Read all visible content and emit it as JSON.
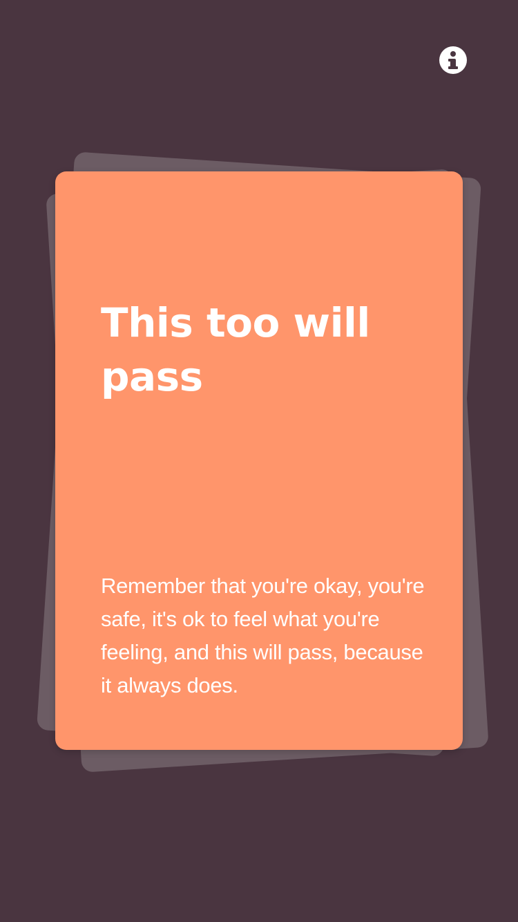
{
  "header": {
    "info_icon": "info-icon"
  },
  "card": {
    "title": "This too will pass",
    "body": "Remember that you're okay, you're safe, it's ok to feel what you're feeling, and this will pass, because it always does."
  },
  "colors": {
    "background": "#4a3540",
    "card": "#ff956b",
    "card_stack": "#6c5c64",
    "text": "#ffffff"
  }
}
